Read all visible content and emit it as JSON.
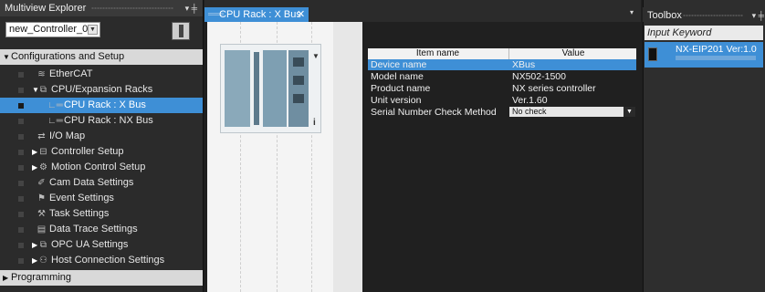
{
  "left_panel": {
    "title": "Multiview Explorer",
    "pin": "▾ ╪",
    "controller": "new_Controller_0",
    "tree": [
      {
        "label": "Configurations and Setup",
        "type": "section",
        "twisty": "▼",
        "level": 0
      },
      {
        "label": "EtherCAT",
        "icon": "≋",
        "level": 2
      },
      {
        "label": "CPU/Expansion Racks",
        "icon": "⧉",
        "twisty": "▼",
        "level": 1
      },
      {
        "label": "CPU Rack : X Bus",
        "icon": "∟═",
        "level": 3,
        "selected": true
      },
      {
        "label": "CPU Rack : NX Bus",
        "icon": "∟═",
        "level": 3
      },
      {
        "label": "I/O Map",
        "icon": "⇄",
        "level": 2
      },
      {
        "label": "Controller Setup",
        "icon": "⊟",
        "twisty": "▶",
        "level": 1
      },
      {
        "label": "Motion Control Setup",
        "icon": "⚙",
        "twisty": "▶",
        "level": 1
      },
      {
        "label": "Cam Data Settings",
        "icon": "✐",
        "level": 2
      },
      {
        "label": "Event Settings",
        "icon": "⚑",
        "level": 2
      },
      {
        "label": "Task Settings",
        "icon": "⚒",
        "level": 2
      },
      {
        "label": "Data Trace Settings",
        "icon": "▤",
        "level": 2
      },
      {
        "label": "OPC UA Settings",
        "icon": "⧉",
        "twisty": "▶",
        "level": 1
      },
      {
        "label": "Host Connection Settings",
        "icon": "⚇",
        "twisty": "▶",
        "level": 1
      },
      {
        "label": "Programming",
        "type": "section",
        "twisty": "▶",
        "level": 0
      }
    ]
  },
  "editor": {
    "tab_label": "CPU Rack : X Bus",
    "tab_close": "✕",
    "tab_menu": "▾",
    "rack_info": "i",
    "props": {
      "col_item": "Item name",
      "col_value": "Value",
      "rows": [
        {
          "key": "Device name",
          "value": "XBus",
          "selected": true
        },
        {
          "key": "Model name",
          "value": "NX502-1500"
        },
        {
          "key": "Product name",
          "value": " NX series controller"
        },
        {
          "key": "Unit version",
          "value": "Ver.1.60"
        },
        {
          "key": "Serial Number Check Method",
          "value": "No check",
          "dropdown": true
        }
      ]
    }
  },
  "toolbox": {
    "title": "Toolbox",
    "pin": "▾ ╪",
    "search_placeholder": "Input Keyword",
    "item_name": "NX-EIP201 Ver:1.0"
  },
  "colors": {
    "accent": "#3e8fd6",
    "section": "#d9d9d9",
    "panel": "#2b2b2b"
  }
}
